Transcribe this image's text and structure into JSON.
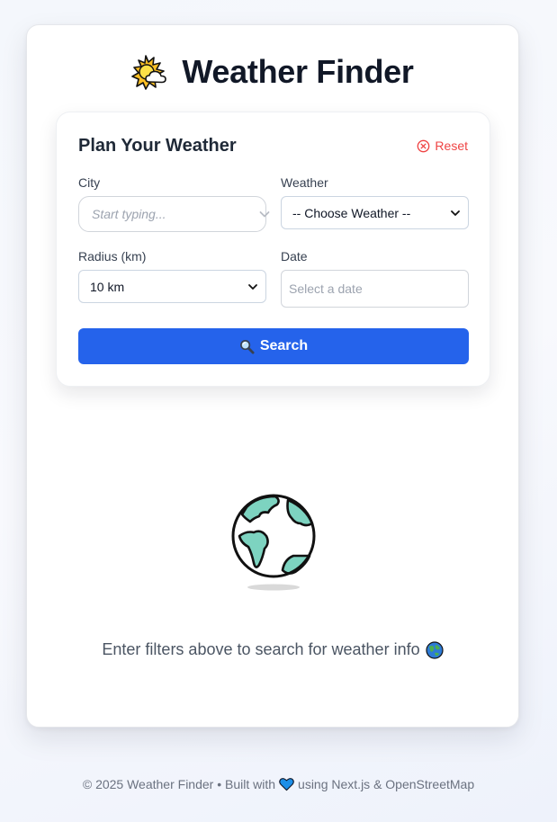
{
  "app": {
    "title": "Weather Finder"
  },
  "panel": {
    "title": "Plan Your Weather",
    "reset_label": "Reset"
  },
  "fields": {
    "city": {
      "label": "City",
      "placeholder": "Start typing..."
    },
    "weather": {
      "label": "Weather",
      "selected": "-- Choose Weather --"
    },
    "radius": {
      "label": "Radius (km)",
      "selected": "10 km"
    },
    "date": {
      "label": "Date",
      "placeholder": "Select a date"
    }
  },
  "search": {
    "label": "Search"
  },
  "empty_state": {
    "message": "Enter filters above to search for weather info"
  },
  "footer": {
    "prefix": "© 2025 Weather Finder • Built with",
    "suffix": "using Next.js & OpenStreetMap"
  },
  "colors": {
    "primary": "#2563eb",
    "danger": "#ef4444",
    "globe_land": "#7dd3c0",
    "heart": "#1d8fe8"
  },
  "icons": {
    "logo": "sun-behind-cloud-icon",
    "reset": "close-circle-icon",
    "city_dropdown": "chevron-down-icon",
    "select_dropdown": "chevron-down-icon",
    "search": "magnifying-glass-icon",
    "empty_state": "globe-icon",
    "empty_message": "globe-emoji-icon",
    "footer": "blue-heart-icon"
  }
}
